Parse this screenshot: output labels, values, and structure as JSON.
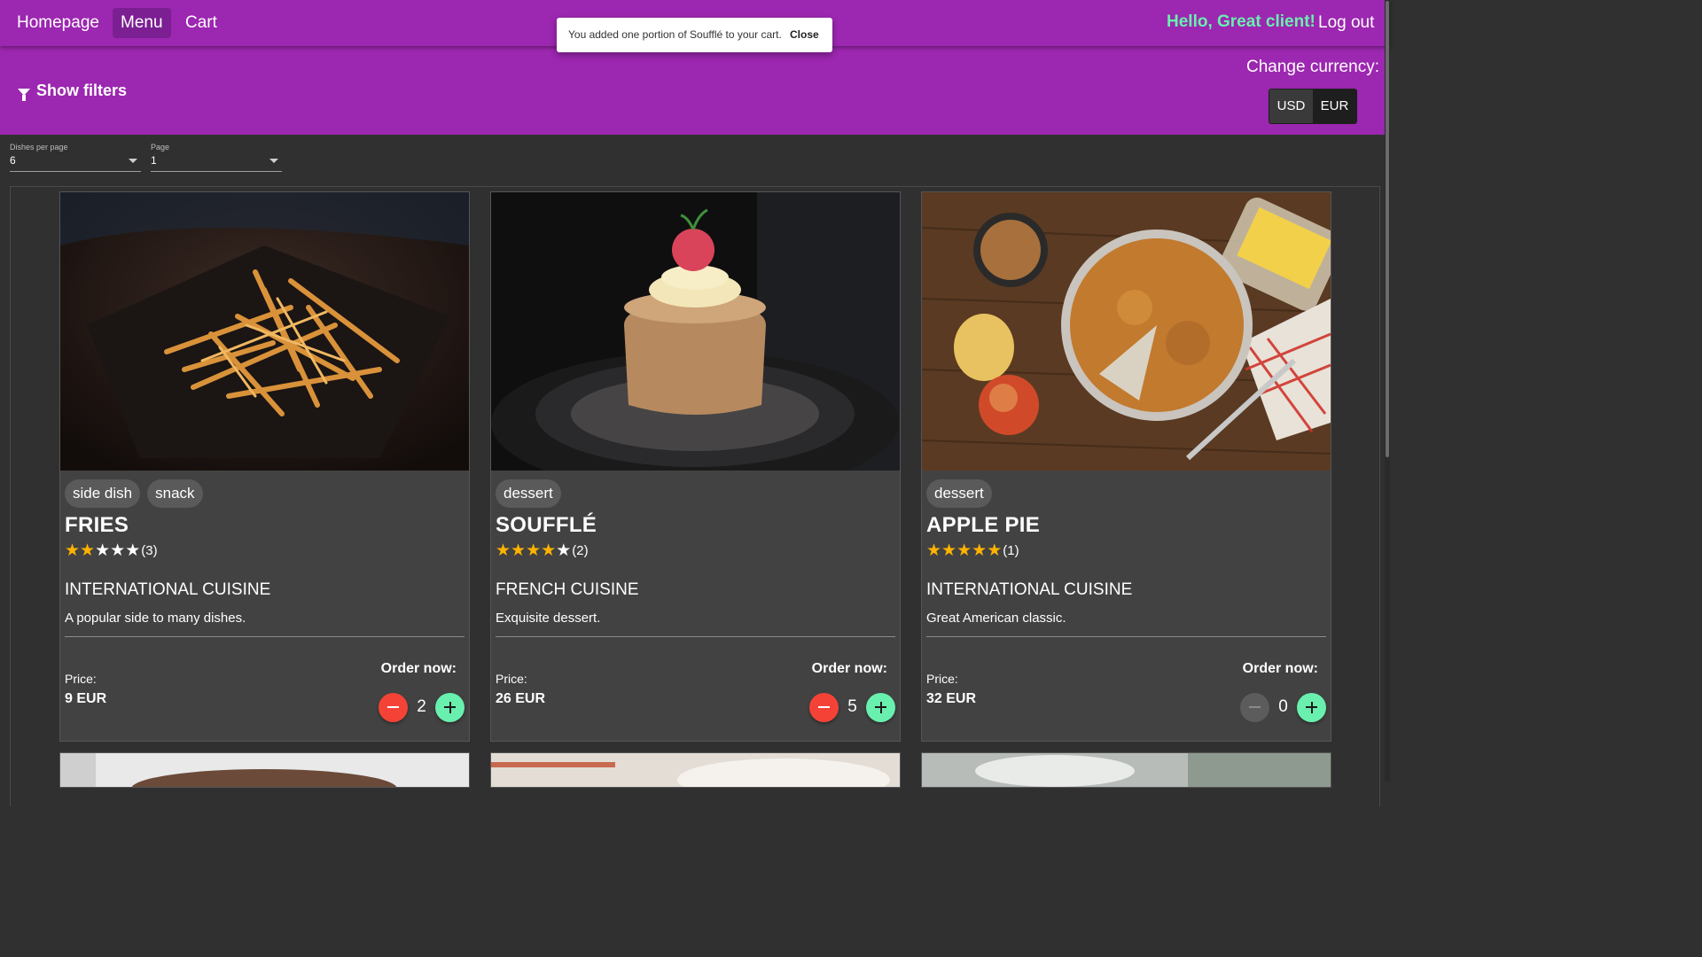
{
  "nav": {
    "items": [
      {
        "label": "Homepage",
        "active": false
      },
      {
        "label": "Menu",
        "active": true
      },
      {
        "label": "Cart",
        "active": false
      }
    ],
    "greeting": "Hello, Great client!",
    "logout": "Log out"
  },
  "toast": {
    "message": "You added one portion of Soufflé to your cart.",
    "close_label": "Close"
  },
  "filters": {
    "show_filters_label": "Show filters",
    "currency_label": "Change currency:",
    "currencies": [
      "USD",
      "EUR"
    ],
    "selected_currency": "EUR"
  },
  "pagination": {
    "per_page_label": "Dishes per page",
    "per_page_value": "6",
    "page_label": "Page",
    "page_value": "1"
  },
  "dishes": [
    {
      "tags": [
        "side dish",
        "snack"
      ],
      "name": "FRIES",
      "rating": 2,
      "rating_count": "(3)",
      "cuisine": "INTERNATIONAL CUISINE",
      "description": "A popular side to many dishes.",
      "price_label": "Price:",
      "price": "9 EUR",
      "order_label": "Order now:",
      "quantity": "2",
      "image": "fries-photo"
    },
    {
      "tags": [
        "dessert"
      ],
      "name": "SOUFFLÉ",
      "rating": 4,
      "rating_count": "(2)",
      "cuisine": "FRENCH CUISINE",
      "description": "Exquisite dessert.",
      "price_label": "Price:",
      "price": "26 EUR",
      "order_label": "Order now:",
      "quantity": "5",
      "image": "souffle-photo"
    },
    {
      "tags": [
        "dessert"
      ],
      "name": "APPLE PIE",
      "rating": 5,
      "rating_count": "(1)",
      "cuisine": "INTERNATIONAL CUISINE",
      "description": "Great American classic.",
      "price_label": "Price:",
      "price": "32 EUR",
      "order_label": "Order now:",
      "quantity": "0",
      "image": "apple-pie-photo"
    }
  ],
  "colors": {
    "primary": "#9c27b0",
    "accent": "#69f0ae",
    "warn": "#f44336",
    "star": "#ffb300",
    "background": "#303030",
    "card": "#424242"
  }
}
